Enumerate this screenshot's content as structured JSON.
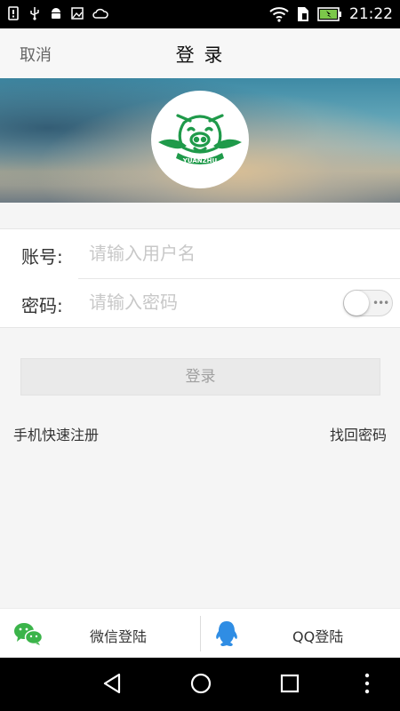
{
  "status_bar": {
    "time": "21:22",
    "left_icons": [
      "notification-icon",
      "usb-icon",
      "android-icon",
      "image-icon",
      "cloud-icon"
    ],
    "right_icons": [
      "wifi-icon",
      "sim-icon",
      "battery-icon"
    ],
    "battery_color": "#7cc84a"
  },
  "header": {
    "cancel_label": "取消",
    "title": "登 录"
  },
  "banner": {
    "logo_icon": "pig-logo-icon",
    "logo_text": "YUANZHU",
    "logo_color": "#1f9a4a"
  },
  "form": {
    "account_label": "账号:",
    "account_placeholder": "请输入用户名",
    "account_value": "",
    "password_label": "密码:",
    "password_placeholder": "请输入密码",
    "password_value": "",
    "show_password_toggle": "off",
    "toggle_dots": "•••"
  },
  "login_button": "登录",
  "links": {
    "register": "手机快速注册",
    "forgot": "找回密码"
  },
  "social": {
    "wechat_label": "微信登陆",
    "qq_label": "QQ登陆",
    "wechat_color": "#3bb44a",
    "qq_color": "#2f8de4"
  },
  "nav_bar": {
    "buttons": [
      "back-icon",
      "home-icon",
      "recents-icon",
      "more-icon"
    ]
  }
}
